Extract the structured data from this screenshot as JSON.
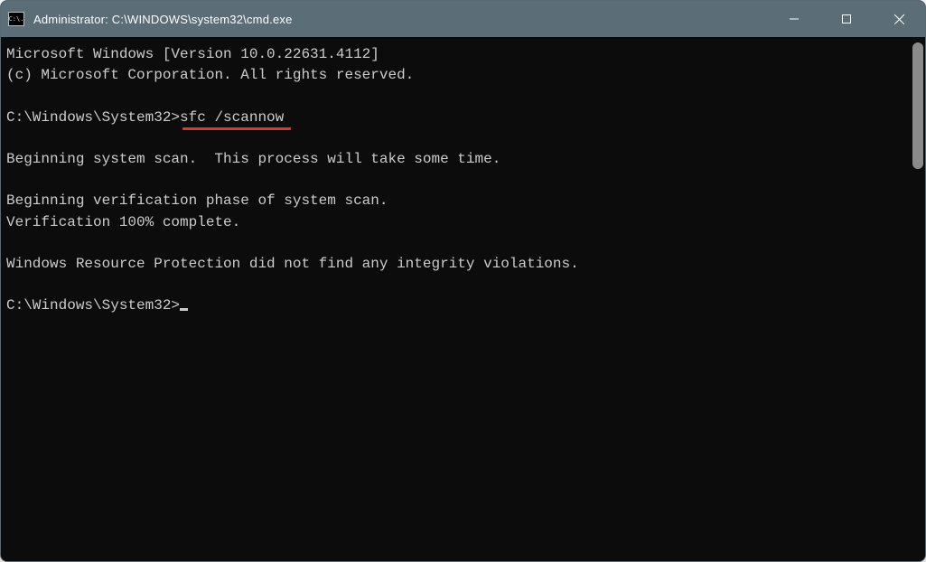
{
  "titlebar": {
    "icon_text": "C:\\.",
    "title": "Administrator: C:\\WINDOWS\\system32\\cmd.exe"
  },
  "terminal": {
    "line1": "Microsoft Windows [Version 10.0.22631.4112]",
    "line2": "(c) Microsoft Corporation. All rights reserved.",
    "prompt1_path": "C:\\Windows\\System32>",
    "prompt1_cmd": "sfc /scannow",
    "line4": "Beginning system scan.  This process will take some time.",
    "line5": "Beginning verification phase of system scan.",
    "line6": "Verification 100% complete.",
    "line7": "Windows Resource Protection did not find any integrity violations.",
    "prompt2_path": "C:\\Windows\\System32>"
  }
}
